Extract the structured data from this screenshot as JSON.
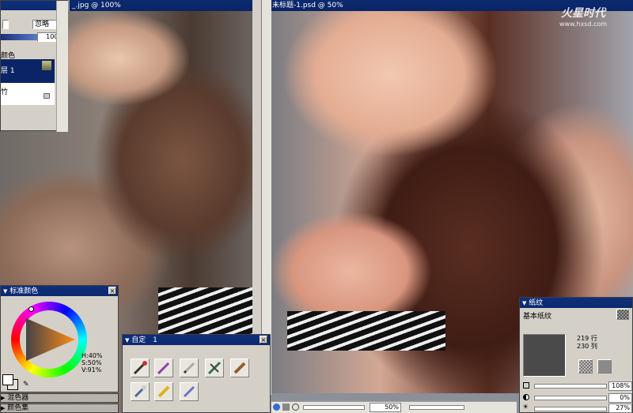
{
  "left_doc": {
    "title": "_.jpg @ 100%"
  },
  "right_doc": {
    "title": "未标题-1.psd @ 50%",
    "zoom_value": "50%"
  },
  "watermark": {
    "brand": "火星时代",
    "url": "www.hxsd.com"
  },
  "layers_panel": {
    "composite_value": "忽略",
    "opacity_value": "100%",
    "section_label": "颜色",
    "layer_1_label": "层 1",
    "layer_2_label": "竹"
  },
  "colors_panel": {
    "title": "标准颜色",
    "hsv": {
      "h": "H:40%",
      "s": "S:50%",
      "v": "V:91%"
    },
    "fg_color": "#ffffff",
    "bg_color": "#e8e0d8"
  },
  "custom_panel": {
    "title": "自定",
    "number": "1"
  },
  "paper_panel": {
    "title": "纸纹",
    "paper_name": "基本纸纹",
    "rows": "219 行",
    "cols": "230 列",
    "scale_value": "108%",
    "contrast_value": "0%",
    "brightness_value": "27%"
  },
  "bottom_panels": {
    "mixer_label": "混色器",
    "colorset_label": "颜色集"
  }
}
